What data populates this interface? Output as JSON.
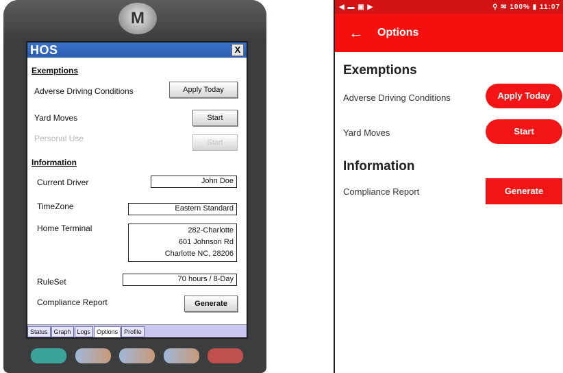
{
  "device": {
    "logo_glyph": "M",
    "window_title": "HOS",
    "close_label": "X",
    "exemptions_heading": "Exemptions",
    "adverse_label": "Adverse Driving Conditions",
    "apply_today_btn": "Apply Today",
    "yard_moves_label": "Yard Moves",
    "yard_start_btn": "Start",
    "personal_use_label": "Personal Use",
    "personal_start_btn": "Start",
    "information_heading": "Information",
    "current_driver_label": "Current Driver",
    "current_driver_value": "John Doe",
    "timezone_label": "TimeZone",
    "timezone_value": "Eastern Standard",
    "home_terminal_label": "Home Terminal",
    "home_terminal_line1": "282-Charlotte",
    "home_terminal_line2": "601 Johnson Rd",
    "home_terminal_line3": "Charlotte NC, 28206",
    "ruleset_label": "RuleSet",
    "ruleset_value": "70 hours / 8-Day",
    "compliance_label": "Compliance Report",
    "generate_btn": "Generate",
    "tabs": [
      "Status",
      "Graph",
      "Logs",
      "Options",
      "Profile"
    ],
    "active_tab": "Options"
  },
  "phone": {
    "status_left": "◀ ▬ ▣ ▶",
    "status_right": "⚲ ✉ 100% ▮ 11:07",
    "back_icon": "←",
    "appbar_title": "Options",
    "exemptions_heading": "Exemptions",
    "adverse_label": "Adverse Driving Conditions",
    "apply_today_btn": "Apply Today",
    "yard_moves_label": "Yard Moves",
    "yard_start_btn": "Start",
    "information_heading": "Information",
    "compliance_label": "Compliance Report",
    "generate_btn": "Generate"
  },
  "colors": {
    "android_red": "#f51010",
    "wm_titlebar": "#2b5db0",
    "tab_strip": "#c8c8f0"
  }
}
